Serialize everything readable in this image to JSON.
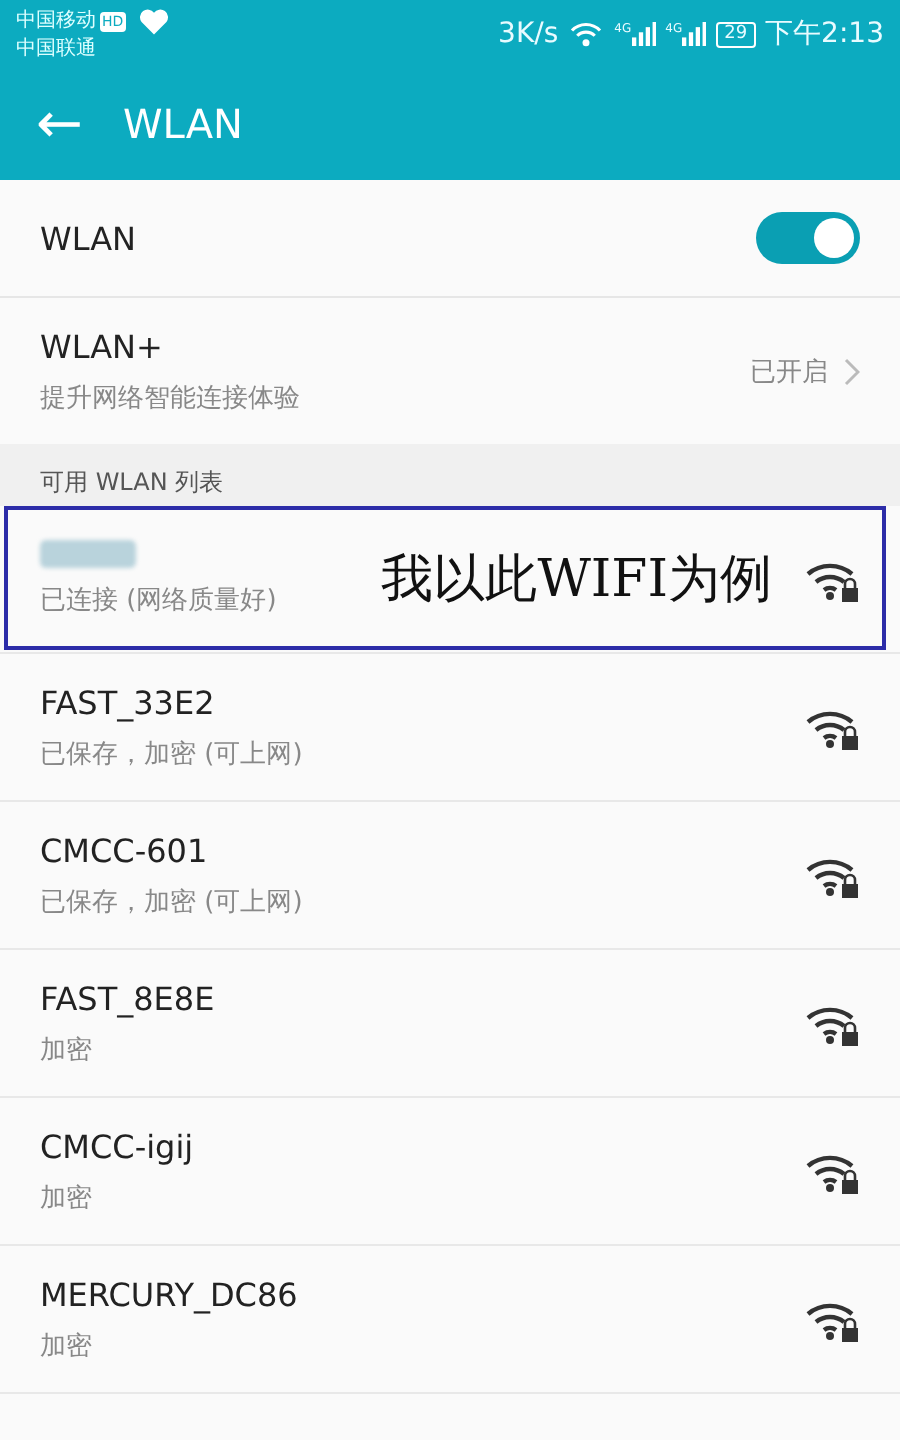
{
  "status_bar": {
    "carriers": [
      "中国移动",
      "中国联通"
    ],
    "carrier_badge": "HD",
    "speed": "3K/s",
    "network_tags": [
      "4G",
      "4G"
    ],
    "battery": "29",
    "time": "下午2:13"
  },
  "header": {
    "back": "←",
    "title": "WLAN"
  },
  "wlan_switch": {
    "label": "WLAN",
    "on": true
  },
  "wlan_plus": {
    "label": "WLAN+",
    "subtitle": "提升网络智能连接体验",
    "value": "已开启"
  },
  "section_title": "可用 WLAN 列表",
  "networks": [
    {
      "kind": "hidden_name",
      "status": "已连接 (网络质量好)"
    },
    {
      "kind": "named",
      "name": "FAST_33E2",
      "status": "已保存，加密 (可上网)"
    },
    {
      "kind": "named",
      "name": "CMCC-601",
      "status": "已保存，加密 (可上网)"
    },
    {
      "kind": "named",
      "name": "FAST_8E8E",
      "status": "加密"
    },
    {
      "kind": "named",
      "name": "CMCC-igij",
      "status": "加密"
    },
    {
      "kind": "named",
      "name": "MERCURY_DC86",
      "status": "加密"
    }
  ],
  "annotation": {
    "text": "我以此WIFI为例"
  }
}
